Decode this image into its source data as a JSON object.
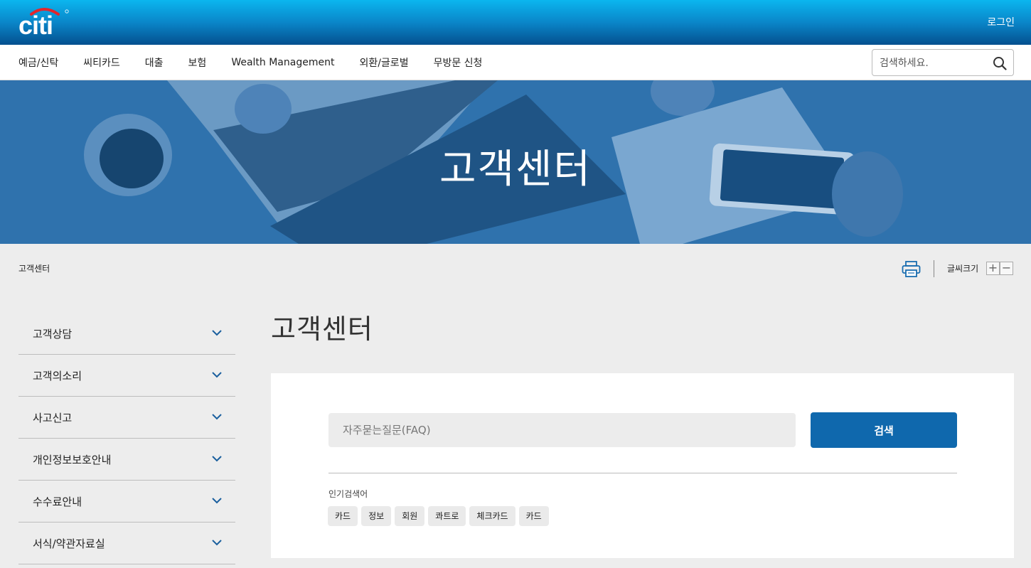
{
  "header": {
    "logo_text": "citi",
    "login_label": "로그인"
  },
  "nav": {
    "items": [
      "예금/신탁",
      "씨티카드",
      "대출",
      "보험",
      "Wealth Management",
      "외환/글로벌",
      "무방문 신청"
    ],
    "search_placeholder": "검색하세요."
  },
  "hero": {
    "title": "고객센터"
  },
  "breadcrumb": {
    "current": "고객센터"
  },
  "utility": {
    "font_size_label": "글씨크기",
    "font_plus": "+",
    "font_minus": "−"
  },
  "sidebar": {
    "items": [
      "고객상담",
      "고객의소리",
      "사고신고",
      "개인정보보호안내",
      "수수료안내",
      "서식/약관자료실"
    ]
  },
  "main": {
    "title": "고객센터",
    "faq_placeholder": "자주묻는질문(FAQ)",
    "search_button": "검색",
    "popular_label": "인기검색어",
    "popular_tags": [
      "카드",
      "정보",
      "회원",
      "콰트로",
      "체크카드",
      "카드"
    ]
  },
  "colors": {
    "brand_blue": "#0f68ad",
    "header_gradient_top": "#0bb6ef",
    "header_gradient_bottom": "#04508f",
    "hero_blue": "#2f6fa8",
    "logo_arc_red": "#e4252b"
  }
}
